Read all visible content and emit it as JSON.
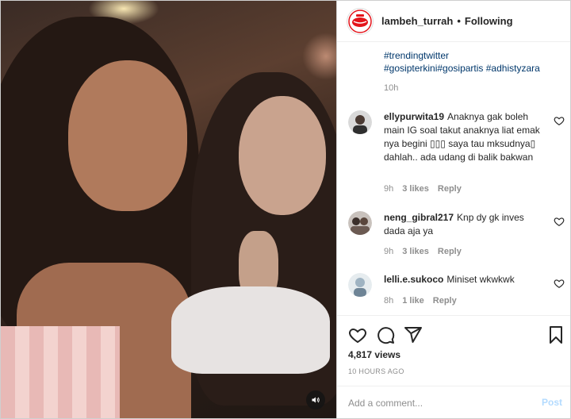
{
  "header": {
    "username": "lambeh_turrah",
    "separator": "•",
    "follow_status": "Following",
    "avatar_icon": "lips-logo-icon"
  },
  "caption": {
    "hashtags": [
      "#trendingtwitter",
      "#gosipterkini",
      "#gosipartis",
      "#adhistyzara"
    ],
    "time": "10h"
  },
  "comments": [
    {
      "username": "ellypurwita19",
      "text": "Anaknya gak boleh main IG soal takut anaknya liat emak nya begini ▯▯▯ saya tau mksudnya▯ dahlah.. ada udang di balik bakwan",
      "time": "9h",
      "likes": "3 likes",
      "reply": "Reply"
    },
    {
      "username": "neng_gibral217",
      "text": "Knp dy gk inves dada aja ya",
      "time": "9h",
      "likes": "3 likes",
      "reply": "Reply"
    },
    {
      "username": "lelli.e.sukoco",
      "text": "Miniset wkwkwk",
      "time": "8h",
      "likes": "1 like",
      "reply": "Reply"
    }
  ],
  "actions": {
    "icons": [
      "heart-icon",
      "comment-icon",
      "share-icon",
      "bookmark-icon"
    ],
    "views": "4,817 views",
    "posted": "10 HOURS AGO"
  },
  "add_comment": {
    "placeholder": "Add a comment...",
    "post_label": "Post"
  },
  "colors": {
    "hashtag": "#00376b",
    "muted": "#8e8e8e",
    "post_disabled": "#b3dbff",
    "brand_red": "#e4141b"
  }
}
